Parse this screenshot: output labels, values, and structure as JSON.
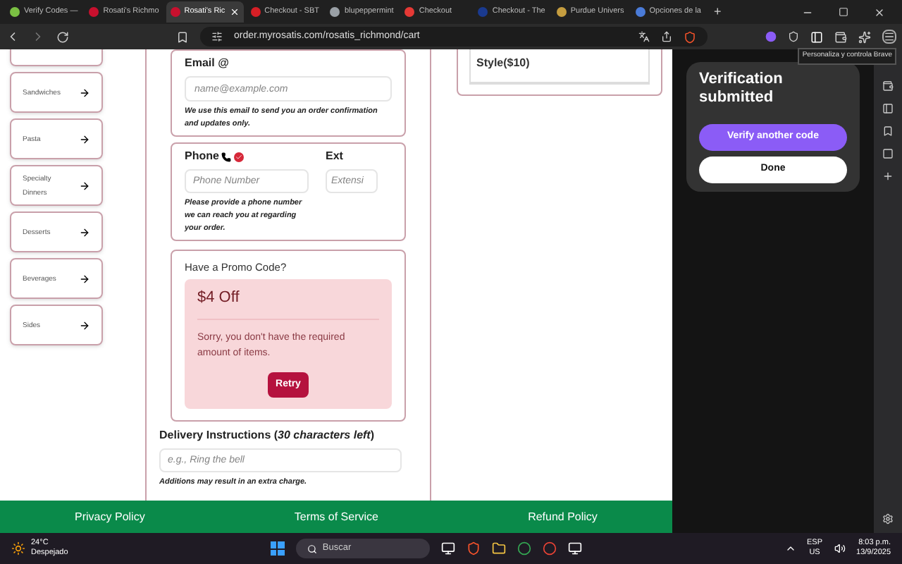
{
  "browser": {
    "tabs": [
      {
        "label": "Verify Codes —",
        "selected": false,
        "color": "#7bc043"
      },
      {
        "label": "Rosati's Richmo",
        "selected": false,
        "color": "#c8102e"
      },
      {
        "label": "Rosati's Ric",
        "selected": true,
        "color": "#c8102e"
      },
      {
        "label": "Checkout - SBT",
        "selected": false,
        "color": "#d61f26"
      },
      {
        "label": "blupeppermint",
        "selected": false,
        "color": "#9aa0a6"
      },
      {
        "label": "Checkout",
        "selected": false,
        "color": "#e53935"
      },
      {
        "label": "Checkout - The",
        "selected": false,
        "color": "#1a3a8f"
      },
      {
        "label": "Purdue Univers",
        "selected": false,
        "color": "#c59d3f"
      },
      {
        "label": "Opciones de la",
        "selected": false,
        "color": "#4a7bd8"
      }
    ],
    "new_tab": "+",
    "url": "order.myrosatis.com/rosatis_richmond/cart",
    "tooltip": "Personaliza y controla Brave"
  },
  "menu": [
    {
      "label": "Sandwiches"
    },
    {
      "label": "Pasta"
    },
    {
      "label": "Specialty Dinners"
    },
    {
      "label": "Desserts"
    },
    {
      "label": "Beverages"
    },
    {
      "label": "Sides"
    }
  ],
  "email": {
    "label": "Email @",
    "placeholder": "name@example.com",
    "note": "We use this email to send you an order confirmation and updates only."
  },
  "phone": {
    "label": "Phone",
    "verified": true,
    "placeholder": "Phone Number",
    "ext_label": "Ext",
    "ext_placeholder": "Extensi",
    "note": "Please provide a phone number we can reach you at regarding your order."
  },
  "promo": {
    "title": "Have a Promo Code?",
    "offer": "$4 Off",
    "message": "Sorry, you don't have the required amount of items.",
    "button": "Retry"
  },
  "delivery": {
    "label": "Delivery Instructions (*30 characters left*)",
    "placeholder": "e.g., Ring the bell",
    "note": "Additions may result in an extra charge."
  },
  "side_card": {
    "text": "Style($10)"
  },
  "footer": [
    "Privacy Policy",
    "Terms of Service",
    "Refund Policy"
  ],
  "panel": {
    "title": "Verification submitted",
    "primary": "Verify another code",
    "secondary": "Done"
  },
  "taskbar": {
    "temp": "24°C",
    "weather": "Despejado",
    "search": "Buscar",
    "lang": "ESP",
    "region": "US",
    "time": "8:03 p.m.",
    "date": "13/9/2025"
  }
}
